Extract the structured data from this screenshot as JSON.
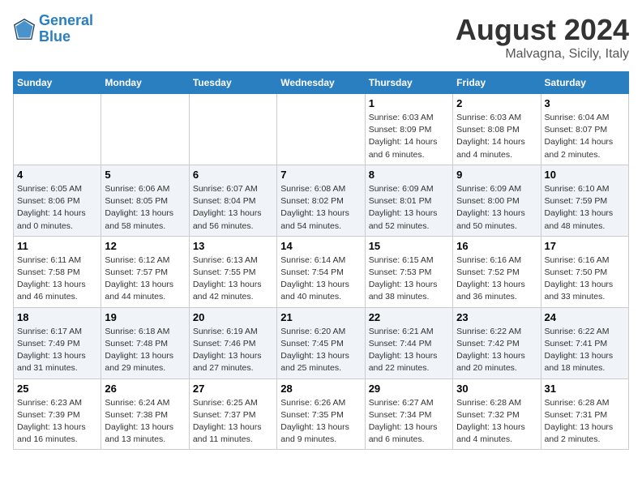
{
  "header": {
    "logo_line1": "General",
    "logo_line2": "Blue",
    "month_title": "August 2024",
    "location": "Malvagna, Sicily, Italy"
  },
  "weekdays": [
    "Sunday",
    "Monday",
    "Tuesday",
    "Wednesday",
    "Thursday",
    "Friday",
    "Saturday"
  ],
  "weeks": [
    [
      {
        "day": "",
        "info": ""
      },
      {
        "day": "",
        "info": ""
      },
      {
        "day": "",
        "info": ""
      },
      {
        "day": "",
        "info": ""
      },
      {
        "day": "1",
        "info": "Sunrise: 6:03 AM\nSunset: 8:09 PM\nDaylight: 14 hours and 6 minutes."
      },
      {
        "day": "2",
        "info": "Sunrise: 6:03 AM\nSunset: 8:08 PM\nDaylight: 14 hours and 4 minutes."
      },
      {
        "day": "3",
        "info": "Sunrise: 6:04 AM\nSunset: 8:07 PM\nDaylight: 14 hours and 2 minutes."
      }
    ],
    [
      {
        "day": "4",
        "info": "Sunrise: 6:05 AM\nSunset: 8:06 PM\nDaylight: 14 hours and 0 minutes."
      },
      {
        "day": "5",
        "info": "Sunrise: 6:06 AM\nSunset: 8:05 PM\nDaylight: 13 hours and 58 minutes."
      },
      {
        "day": "6",
        "info": "Sunrise: 6:07 AM\nSunset: 8:04 PM\nDaylight: 13 hours and 56 minutes."
      },
      {
        "day": "7",
        "info": "Sunrise: 6:08 AM\nSunset: 8:02 PM\nDaylight: 13 hours and 54 minutes."
      },
      {
        "day": "8",
        "info": "Sunrise: 6:09 AM\nSunset: 8:01 PM\nDaylight: 13 hours and 52 minutes."
      },
      {
        "day": "9",
        "info": "Sunrise: 6:09 AM\nSunset: 8:00 PM\nDaylight: 13 hours and 50 minutes."
      },
      {
        "day": "10",
        "info": "Sunrise: 6:10 AM\nSunset: 7:59 PM\nDaylight: 13 hours and 48 minutes."
      }
    ],
    [
      {
        "day": "11",
        "info": "Sunrise: 6:11 AM\nSunset: 7:58 PM\nDaylight: 13 hours and 46 minutes."
      },
      {
        "day": "12",
        "info": "Sunrise: 6:12 AM\nSunset: 7:57 PM\nDaylight: 13 hours and 44 minutes."
      },
      {
        "day": "13",
        "info": "Sunrise: 6:13 AM\nSunset: 7:55 PM\nDaylight: 13 hours and 42 minutes."
      },
      {
        "day": "14",
        "info": "Sunrise: 6:14 AM\nSunset: 7:54 PM\nDaylight: 13 hours and 40 minutes."
      },
      {
        "day": "15",
        "info": "Sunrise: 6:15 AM\nSunset: 7:53 PM\nDaylight: 13 hours and 38 minutes."
      },
      {
        "day": "16",
        "info": "Sunrise: 6:16 AM\nSunset: 7:52 PM\nDaylight: 13 hours and 36 minutes."
      },
      {
        "day": "17",
        "info": "Sunrise: 6:16 AM\nSunset: 7:50 PM\nDaylight: 13 hours and 33 minutes."
      }
    ],
    [
      {
        "day": "18",
        "info": "Sunrise: 6:17 AM\nSunset: 7:49 PM\nDaylight: 13 hours and 31 minutes."
      },
      {
        "day": "19",
        "info": "Sunrise: 6:18 AM\nSunset: 7:48 PM\nDaylight: 13 hours and 29 minutes."
      },
      {
        "day": "20",
        "info": "Sunrise: 6:19 AM\nSunset: 7:46 PM\nDaylight: 13 hours and 27 minutes."
      },
      {
        "day": "21",
        "info": "Sunrise: 6:20 AM\nSunset: 7:45 PM\nDaylight: 13 hours and 25 minutes."
      },
      {
        "day": "22",
        "info": "Sunrise: 6:21 AM\nSunset: 7:44 PM\nDaylight: 13 hours and 22 minutes."
      },
      {
        "day": "23",
        "info": "Sunrise: 6:22 AM\nSunset: 7:42 PM\nDaylight: 13 hours and 20 minutes."
      },
      {
        "day": "24",
        "info": "Sunrise: 6:22 AM\nSunset: 7:41 PM\nDaylight: 13 hours and 18 minutes."
      }
    ],
    [
      {
        "day": "25",
        "info": "Sunrise: 6:23 AM\nSunset: 7:39 PM\nDaylight: 13 hours and 16 minutes."
      },
      {
        "day": "26",
        "info": "Sunrise: 6:24 AM\nSunset: 7:38 PM\nDaylight: 13 hours and 13 minutes."
      },
      {
        "day": "27",
        "info": "Sunrise: 6:25 AM\nSunset: 7:37 PM\nDaylight: 13 hours and 11 minutes."
      },
      {
        "day": "28",
        "info": "Sunrise: 6:26 AM\nSunset: 7:35 PM\nDaylight: 13 hours and 9 minutes."
      },
      {
        "day": "29",
        "info": "Sunrise: 6:27 AM\nSunset: 7:34 PM\nDaylight: 13 hours and 6 minutes."
      },
      {
        "day": "30",
        "info": "Sunrise: 6:28 AM\nSunset: 7:32 PM\nDaylight: 13 hours and 4 minutes."
      },
      {
        "day": "31",
        "info": "Sunrise: 6:28 AM\nSunset: 7:31 PM\nDaylight: 13 hours and 2 minutes."
      }
    ]
  ]
}
